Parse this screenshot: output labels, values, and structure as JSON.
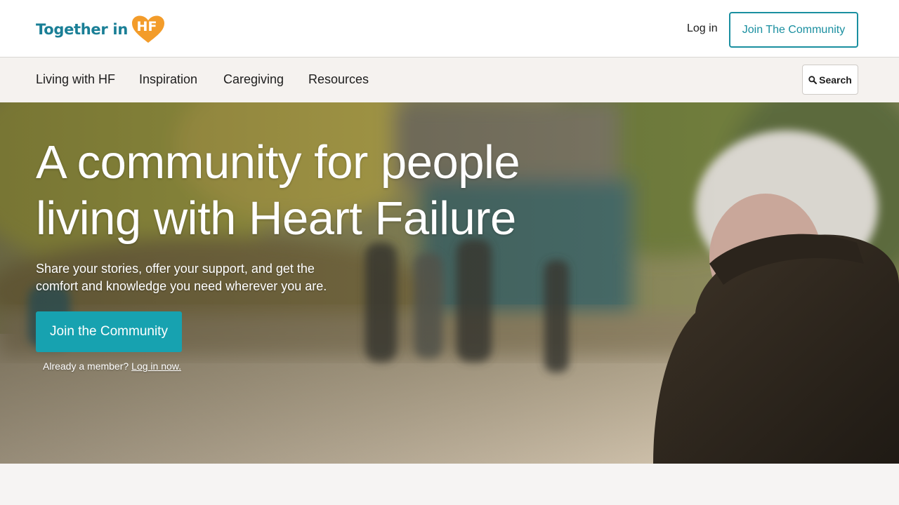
{
  "header": {
    "logo_text": "Together in",
    "logo_badge": "HF",
    "login_label": "Log in",
    "join_label": "Join The Community"
  },
  "nav": {
    "items": [
      {
        "label": "Living with HF"
      },
      {
        "label": "Inspiration"
      },
      {
        "label": "Caregiving"
      },
      {
        "label": "Resources"
      }
    ],
    "search_label": "Search"
  },
  "hero": {
    "title_line1": "A community for people",
    "title_line2": "living with Heart Failure",
    "subtitle": "Share your stories, offer your support, and get the comfort and knowledge you need wherever you are.",
    "join_label": "Join the Community",
    "member_prompt": "Already a member?",
    "member_link": "Log in now."
  },
  "colors": {
    "brand_teal": "#1a7f96",
    "accent_orange": "#f39c2a",
    "button_teal": "#17a2b0"
  },
  "icons": [
    "heart-logo-icon",
    "search-icon"
  ]
}
